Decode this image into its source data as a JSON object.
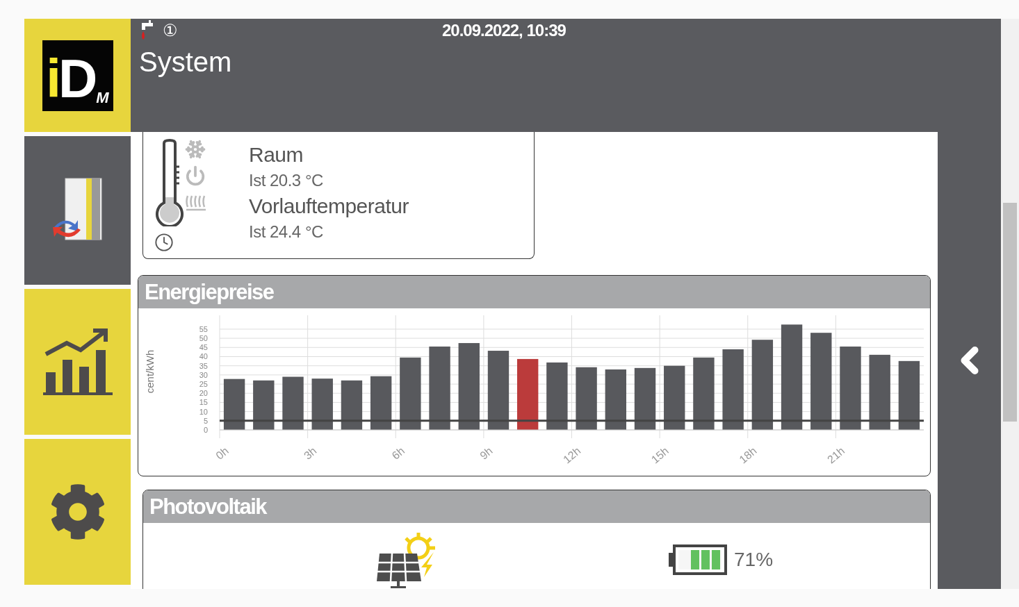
{
  "nav": [
    {
      "kind": "logo",
      "selected": false,
      "letters": [
        "i",
        "D",
        "M"
      ]
    },
    {
      "kind": "system",
      "selected": true
    },
    {
      "kind": "stats",
      "selected": false
    },
    {
      "kind": "settings",
      "selected": false
    }
  ],
  "header": {
    "badge": "①",
    "date_time": "20.09.2022, 10:39",
    "title": "System"
  },
  "room_card": {
    "rows": [
      {
        "label": "Raum",
        "value": "Ist 20.3 °C"
      },
      {
        "label": "Vorlauftemperatur",
        "value": "Ist 24.4 °C"
      }
    ]
  },
  "energy": {
    "title": "Energiepreise",
    "chart_data": {
      "type": "bar",
      "ylabel": "cent/kWh",
      "grid": true,
      "xlim": [
        0,
        24
      ],
      "x": [
        0.5,
        1.5,
        2.5,
        3.5,
        4.5,
        5.5,
        6.5,
        7.5,
        8.5,
        9.5,
        10.5,
        11.5,
        12.5,
        13.5,
        14.5,
        15.5,
        16.5,
        17.5,
        18.5,
        19.5,
        20.5,
        21.5,
        22.5,
        23.5
      ],
      "series": [
        {
          "color": "#58595d",
          "values": [
            27.8,
            27,
            29,
            28,
            27,
            29.3,
            39.5,
            45.5,
            47.4,
            43.2,
            null,
            36.8,
            34.2,
            33,
            33.8,
            35,
            39.5,
            44,
            49.2,
            57.5,
            53,
            45.5,
            41,
            37.6
          ]
        },
        {
          "color": "#bb3b3b",
          "values": [
            null,
            null,
            null,
            null,
            null,
            null,
            null,
            null,
            null,
            null,
            38.7,
            null,
            null,
            null,
            null,
            null,
            null,
            null,
            null,
            null,
            null,
            null,
            null,
            null
          ]
        }
      ],
      "ylim": [
        0,
        58
      ],
      "yticks": [
        0,
        5,
        10,
        15,
        20,
        25,
        30,
        35,
        40,
        45,
        50,
        55
      ],
      "xticks": [
        {
          "value": 0,
          "label": "0h"
        },
        {
          "value": 3,
          "label": "3h"
        },
        {
          "value": 6,
          "label": "6h"
        },
        {
          "value": 9,
          "label": "9h"
        },
        {
          "value": 12,
          "label": "12h"
        },
        {
          "value": 15,
          "label": "15h"
        },
        {
          "value": 18,
          "label": "18h"
        },
        {
          "value": 21,
          "label": "21h"
        }
      ],
      "ref_lines": [
        {
          "axis": "y",
          "value": 5
        }
      ]
    }
  },
  "photovoltaik": {
    "title": "Photovoltaik",
    "battery": {
      "level": 0.71,
      "reading": "71%"
    }
  }
}
